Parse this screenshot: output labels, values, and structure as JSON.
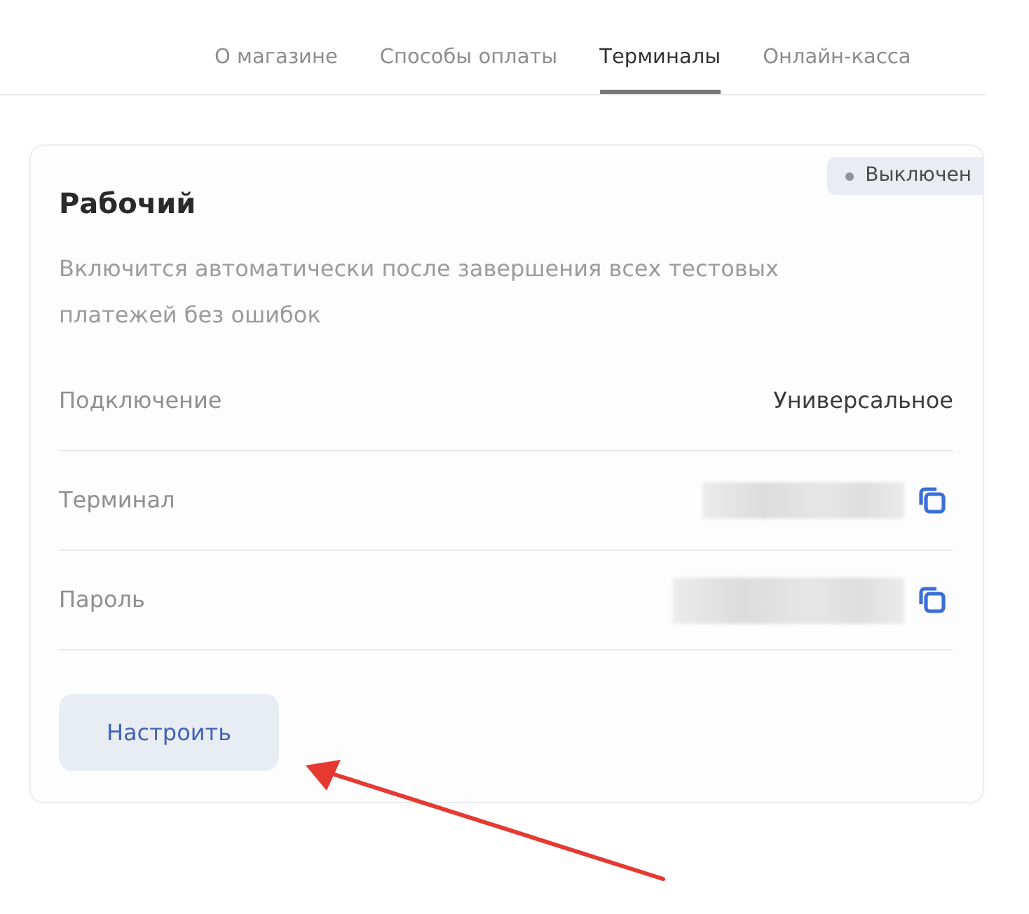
{
  "tabs": [
    {
      "label": "О магазине",
      "selected": false
    },
    {
      "label": "Способы оплаты",
      "selected": false
    },
    {
      "label": "Терминалы",
      "selected": true
    },
    {
      "label": "Онлайн-касса",
      "selected": false
    }
  ],
  "terminal": {
    "title": "Рабочий",
    "status": {
      "label": "Выключен",
      "on": false
    },
    "description": "Включится автоматически после завершения всех тестовых платежей без ошибок",
    "rows": [
      {
        "kind": "text",
        "label": "Подключение",
        "value": "Универсальное"
      },
      {
        "kind": "hidden",
        "label": "Терминал"
      },
      {
        "kind": "hidden",
        "label": "Пароль"
      }
    ],
    "button": "Настроить"
  }
}
